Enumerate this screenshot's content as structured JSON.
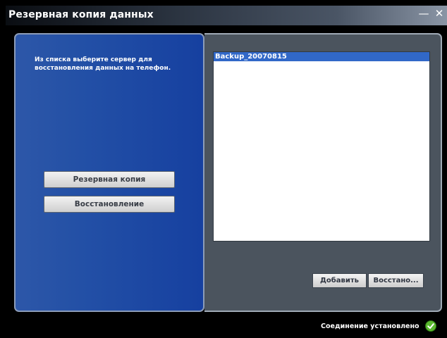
{
  "window": {
    "title": "Резервная копия данных",
    "minimize_glyph": "—",
    "close_glyph": "✕"
  },
  "left_panel": {
    "instruction": "Из списка выберите сервер для восстановления данных на телефон.",
    "backup_button": "Резервная копия",
    "restore_button": "Восстановление"
  },
  "right_panel": {
    "list_items": [
      {
        "label": "Backup_20070815",
        "selected": true
      }
    ],
    "add_button": "Добавить",
    "restore_button": "Восстано..."
  },
  "status": {
    "text": "Соединение установлено",
    "icon": "check-circle-icon",
    "icon_color": "#5bb830"
  },
  "colors": {
    "left_panel": "#2350a6",
    "right_panel": "#4b545e",
    "selection": "#3168c8"
  }
}
